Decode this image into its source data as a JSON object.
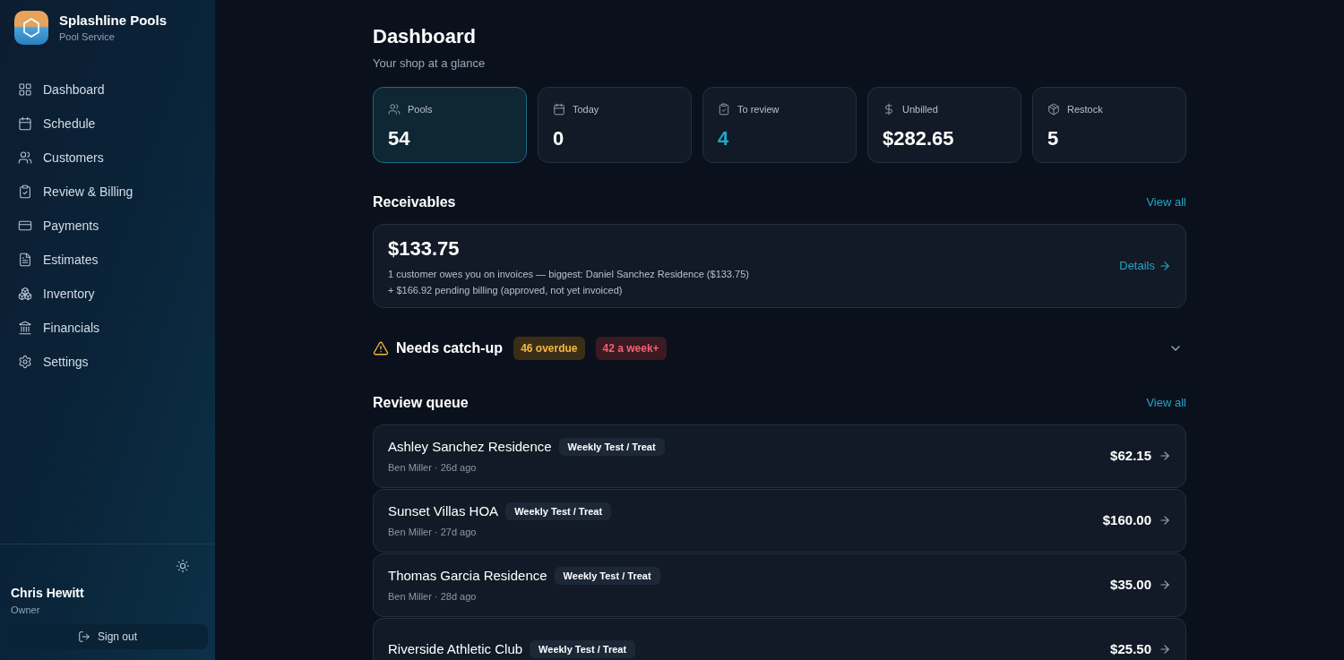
{
  "brand": {
    "name": "Splashline Pools",
    "subtitle": "Pool Service"
  },
  "nav": [
    {
      "label": "Dashboard"
    },
    {
      "label": "Schedule"
    },
    {
      "label": "Customers"
    },
    {
      "label": "Review & Billing"
    },
    {
      "label": "Payments"
    },
    {
      "label": "Estimates"
    },
    {
      "label": "Inventory"
    },
    {
      "label": "Financials"
    },
    {
      "label": "Settings"
    }
  ],
  "user": {
    "name": "Chris Hewitt",
    "role": "Owner",
    "sign_out": "Sign out"
  },
  "page": {
    "title": "Dashboard",
    "subtitle": "Your shop at a glance"
  },
  "stats": [
    {
      "label": "Pools",
      "value": "54",
      "highlighted": true,
      "accent": false
    },
    {
      "label": "Today",
      "value": "0",
      "highlighted": false,
      "accent": false
    },
    {
      "label": "To review",
      "value": "4",
      "highlighted": false,
      "accent": true
    },
    {
      "label": "Unbilled",
      "value": "$282.65",
      "highlighted": false,
      "accent": false
    },
    {
      "label": "Restock",
      "value": "5",
      "highlighted": false,
      "accent": false
    }
  ],
  "receivables": {
    "title": "Receivables",
    "link": "View all",
    "amount": "$133.75",
    "line_1": "1 customer owes you on invoices — biggest: Daniel Sanchez Residence ($133.75)",
    "line_2": "+ $166.92 pending billing (approved, not yet invoiced)",
    "details": "Details"
  },
  "catch_up": {
    "title": "Needs catch-up",
    "expanded": false,
    "badges": [
      {
        "text": "46 overdue",
        "kind": "warning"
      },
      {
        "text": "42 a week+",
        "kind": "danger"
      }
    ]
  },
  "review_queue": {
    "title": "Review queue",
    "link": "View all",
    "rows": [
      {
        "name": "Ashley Sanchez Residence",
        "tag": "Weekly Test / Treat",
        "meta": "Ben Miller · 26d ago",
        "amount": "$62.15"
      },
      {
        "name": "Sunset Villas HOA",
        "tag": "Weekly Test / Treat",
        "meta": "Ben Miller · 27d ago",
        "amount": "$160.00"
      },
      {
        "name": "Thomas Garcia Residence",
        "tag": "Weekly Test / Treat",
        "meta": "Ben Miller · 28d ago",
        "amount": "$35.00"
      },
      {
        "name": "Riverside Athletic Club",
        "tag": "Weekly Test / Treat",
        "amount": "$25.50"
      }
    ]
  }
}
